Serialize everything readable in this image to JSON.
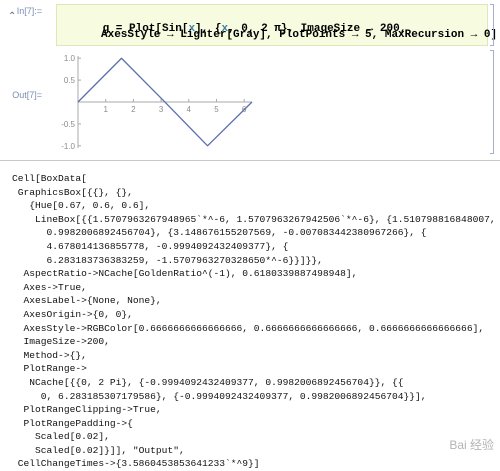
{
  "input_label": "In[7]:=",
  "output_label": "Out[7]=",
  "input_code": {
    "line1_prefix": "g = Plot[Sin[",
    "line1_var1": "x",
    "line1_mid": "], {",
    "line1_var2": "x",
    "line1_suffix": ", 0, 2 π}, ImageSize → 200,",
    "line2": "AxesStyle → Lighter[Gray], PlotPoints → 5, MaxRecursion → 0]"
  },
  "plot": {
    "axis_color": "#a8a8a8",
    "line_color": "#5b6fae",
    "x_tick_labels": [
      "1",
      "2",
      "3",
      "4",
      "5",
      "6"
    ],
    "y_tick_labels": [
      "1.0",
      "0.5",
      "-0.5",
      "-1.0"
    ],
    "points": [
      {
        "x": 0,
        "y": 0
      },
      {
        "x": 1.5707963267948966,
        "y": 0.9982006892456704
      },
      {
        "x": 3.148676155207569,
        "y": -0.007083442380967266
      },
      {
        "x": 4.678014136855778,
        "y": -0.9994092432409377
      },
      {
        "x": 6.283183736383259,
        "y": -1.570796327032865e-06
      }
    ],
    "xlim": [
      0,
      6.28318530717958
    ],
    "ylim": [
      -0.9994092432409377,
      0.9982006892456704
    ]
  },
  "cell_expression": [
    "Cell[BoxData[",
    " GraphicsBox[{{}, {},",
    "   {Hue[0.67, 0.6, 0.6],",
    "    LineBox[{{1.5707963267948965`*^-6, 1.5707963267942506`*^-6}, {1.510798816848007,",
    "      0.9982006892456704}, {3.148676155207569, -0.007083442380967266}, {",
    "      4.678014136855778, -0.9994092432409377}, {",
    "      6.283183736383259, -1.5707963270328650*^-6}}]}},",
    "  AspectRatio->NCache[GoldenRatio^(-1), 0.6180339887498948],",
    "  Axes->True,",
    "  AxesLabel->{None, None},",
    "  AxesOrigin->{0, 0},",
    "  AxesStyle->RGBColor[0.6666666666666666, 0.6666666666666666, 0.6666666666666666],",
    "  ImageSize->200,",
    "  Method->{},",
    "  PlotRange->",
    "   NCache[{{0, 2 Pi}, {-0.9994092432409377, 0.9982006892456704}}, {{",
    "     0, 6.283185307179586}, {-0.9994092432409377, 0.9982006892456704}}],",
    "  PlotRangeClipping->True,",
    "  PlotRangePadding->{",
    "    Scaled[0.02],",
    "    Scaled[0.02]}]], \"Output\",",
    " CellChangeTimes->{3.5860453853641233`*^9}]"
  ],
  "watermark": "Bai 经验"
}
